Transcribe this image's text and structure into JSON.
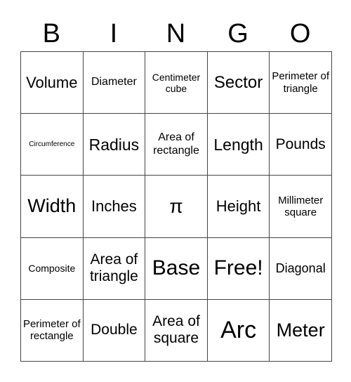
{
  "header": [
    "B",
    "I",
    "N",
    "G",
    "O"
  ],
  "grid": [
    [
      {
        "text": "Volume",
        "size": 22
      },
      {
        "text": "Diameter",
        "size": 16
      },
      {
        "text": "Centimeter cube",
        "size": 14
      },
      {
        "text": "Sector",
        "size": 24
      },
      {
        "text": "Perimeter of triangle",
        "size": 15
      }
    ],
    [
      {
        "text": "Circumference",
        "size": 10
      },
      {
        "text": "Radius",
        "size": 23
      },
      {
        "text": "Area of rectangle",
        "size": 16
      },
      {
        "text": "Length",
        "size": 23
      },
      {
        "text": "Pounds",
        "size": 21
      }
    ],
    [
      {
        "text": "Width",
        "size": 27
      },
      {
        "text": "Inches",
        "size": 22
      },
      {
        "text": "π",
        "size": 28
      },
      {
        "text": "Height",
        "size": 22
      },
      {
        "text": "Millimeter square",
        "size": 15
      }
    ],
    [
      {
        "text": "Composite",
        "size": 14
      },
      {
        "text": "Area of triangle",
        "size": 21
      },
      {
        "text": "Base",
        "size": 30
      },
      {
        "text": "Free!",
        "size": 30
      },
      {
        "text": "Diagonal",
        "size": 18
      }
    ],
    [
      {
        "text": "Perimeter of rectangle",
        "size": 15
      },
      {
        "text": "Double",
        "size": 21
      },
      {
        "text": "Area of square",
        "size": 21
      },
      {
        "text": "Arc",
        "size": 34
      },
      {
        "text": "Meter",
        "size": 27
      }
    ]
  ]
}
